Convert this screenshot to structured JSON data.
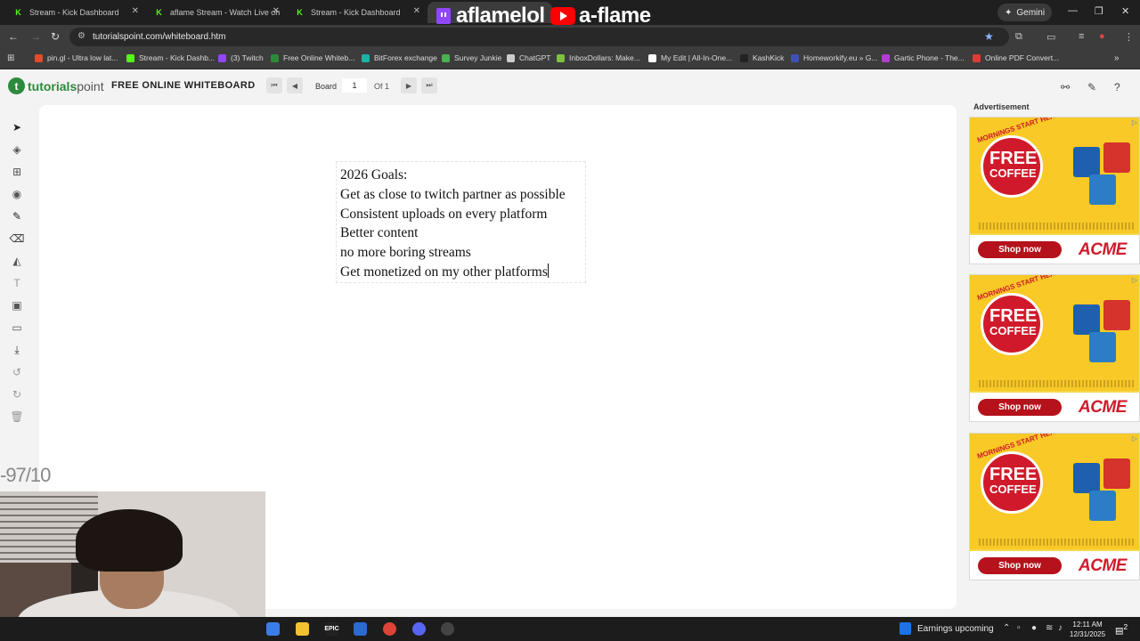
{
  "browser": {
    "tabs": [
      {
        "title": "Stream - Kick Dashboard",
        "favicon": "kick-icon"
      },
      {
        "title": "aflame Stream - Watch Live on",
        "favicon": "kick-icon"
      },
      {
        "title": "Stream - Kick Dashboard",
        "favicon": "kick-icon"
      }
    ],
    "gemini_label": "Gemini",
    "url": "tutorialspoint.com/whiteboard.htm",
    "bookmarks": [
      {
        "label": "pin.gl - Ultra low lat...",
        "color": "#e34c26"
      },
      {
        "label": "Stream - Kick Dashb...",
        "color": "#53fc18"
      },
      {
        "label": "(3) Twitch",
        "color": "#9146ff"
      },
      {
        "label": "Free Online Whiteb...",
        "color": "#2c8a3c"
      },
      {
        "label": "BitForex exchange",
        "color": "#1bb3a5"
      },
      {
        "label": "Survey Junkie",
        "color": "#4caf50"
      },
      {
        "label": "ChatGPT",
        "color": "#cccccc"
      },
      {
        "label": "InboxDollars: Make...",
        "color": "#7cc142"
      },
      {
        "label": "My Edit | All-In-One...",
        "color": "#ffffff"
      },
      {
        "label": "KashKick",
        "color": "#222222"
      },
      {
        "label": "Homeworkify.eu » G...",
        "color": "#3f51b5"
      },
      {
        "label": "Gartic Phone - The...",
        "color": "#b23bd4"
      },
      {
        "label": "Online PDF Convert...",
        "color": "#e53935"
      }
    ]
  },
  "overlay": {
    "twitch_name": "aflamelol",
    "youtube_name": "a-flame",
    "score": "-97/10"
  },
  "app": {
    "logo_brand": "tutorials",
    "logo_point": "point",
    "title": "FREE ONLINE WHITEBOARD",
    "board_label": "Board",
    "board_number": "1",
    "board_of": "Of 1"
  },
  "whiteboard": {
    "lines": [
      "2026 Goals:",
      "Get as close to twitch partner as possible",
      "Consistent uploads on every platform",
      "Better content",
      "no more boring streams",
      "Get monetized on my other platforms"
    ]
  },
  "ads": {
    "heading": "Advertisement",
    "banner": "MORNINGS START HERE!",
    "free": "FREE",
    "coffee": "COFFEE",
    "shop_label": "Shop now",
    "brand": "ACME"
  },
  "taskbar": {
    "earnings": "Earnings upcoming",
    "time": "12:11 AM",
    "date": "12/31/2025",
    "notifications": "2"
  }
}
